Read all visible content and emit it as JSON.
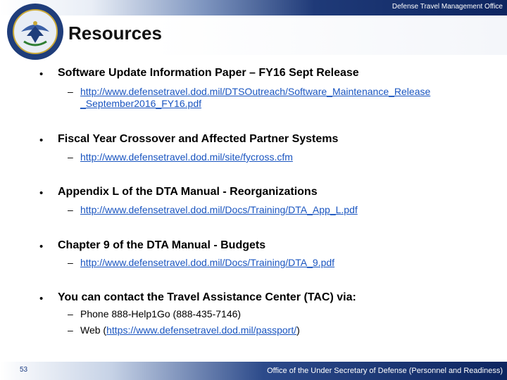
{
  "header": {
    "office": "Defense Travel Management Office",
    "title": "Resources"
  },
  "logo": {
    "icon": "dod-seal-icon"
  },
  "bullets": [
    {
      "text": "Software Update Information Paper – FY16 Sept Release",
      "subs": [
        {
          "dash": "–",
          "link_line1": "http://www.defensetravel.dod.mil/DTSOutreach/Software_Maintenance_Release",
          "link_line2": "_September2016_FY16.pdf"
        }
      ]
    },
    {
      "text": "Fiscal Year Crossover and Affected Partner Systems",
      "subs": [
        {
          "dash": "–",
          "link": "http://www.defensetravel.dod.mil/site/fycross.cfm"
        }
      ]
    },
    {
      "text": "Appendix L of the DTA Manual - Reorganizations",
      "subs": [
        {
          "dash": "–",
          "link": "http://www.defensetravel.dod.mil/Docs/Training/DTA_App_L.pdf"
        }
      ]
    },
    {
      "text": "Chapter 9 of the DTA Manual - Budgets",
      "subs": [
        {
          "dash": "–",
          "link": "http://www.defensetravel.dod.mil/Docs/Training/DTA_9.pdf"
        }
      ]
    },
    {
      "text": "You can contact the Travel Assistance Center (TAC) via:",
      "subs": [
        {
          "dash": "–",
          "text": "Phone 888-Help1Go (888-435-7146)"
        },
        {
          "dash": "–",
          "text_before": "Web (",
          "link": "https://www.defensetravel.dod.mil/passport/",
          "text_after": ")"
        }
      ]
    }
  ],
  "footer": {
    "page_number": "53",
    "org": "Office of the Under Secretary of Defense (Personnel and Readiness)"
  },
  "colors": {
    "link": "#1a55c0",
    "band": "#0d2560"
  }
}
